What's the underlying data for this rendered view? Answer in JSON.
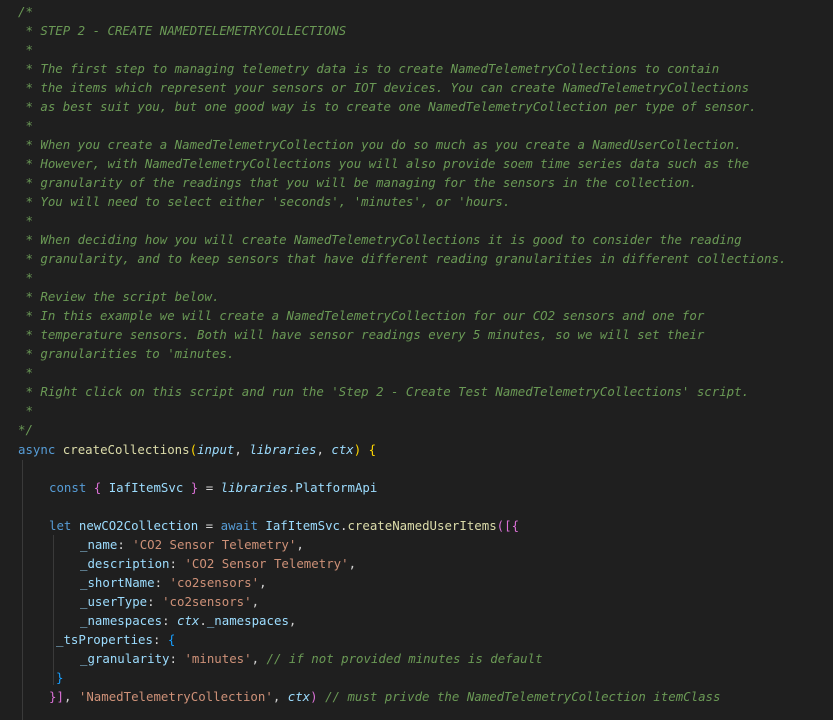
{
  "editor": {
    "comment": {
      "lines": [
        "/*",
        " * STEP 2 - CREATE NAMEDTELEMETRYCOLLECTIONS",
        " *",
        " * The first step to managing telemetry data is to create NamedTelemetryCollections to contain",
        " * the items which represent your sensors or IOT devices. You can create NamedTelemetryCollections",
        " * as best suit you, but one good way is to create one NamedTelemetryCollection per type of sensor.",
        " *",
        " * When you create a NamedTelemetryCollection you do so much as you create a NamedUserCollection.",
        " * However, with NamedTelemetryCollections you will also provide soem time series data such as the",
        " * granularity of the readings that you will be managing for the sensors in the collection.",
        " * You will need to select either 'seconds', 'minutes', or 'hours.",
        " *",
        " * When deciding how you will create NamedTelemetryCollections it is good to consider the reading",
        " * granularity, and to keep sensors that have different reading granularities in different collections.",
        " *",
        " * Review the script below.",
        " * In this example we will create a NamedTelemetryCollection for our CO2 sensors and one for",
        " * temperature sensors. Both will have sensor readings every 5 minutes, so we will set their",
        " * granularities to 'minutes.",
        " *",
        " * Right click on this script and run the 'Step 2 - Create Test NamedTelemetryCollections' script.",
        " *",
        "*/"
      ]
    },
    "code": {
      "async_kw": "async",
      "fn_name": "createCollections",
      "open_paren": "(",
      "p_input": "input",
      "p_libraries": "libraries",
      "p_ctx": "ctx",
      "comma_sep": ", ",
      "close_paren_brace": ") {",
      "const_kw": "const",
      "destructure_open": "{",
      "iaf_svc": "IafItemSvc",
      "destructure_close": "}",
      "equals": " = ",
      "libraries_ref": "libraries",
      "dot": ".",
      "platform_api": "PlatformApi",
      "let_kw": "let",
      "new_var": "newCO2Collection",
      "await_kw": "await",
      "method": "createNamedUserItems",
      "open_call": "([{",
      "k_name": "_name",
      "v_name": "'CO2 Sensor Telemetry'",
      "k_description": "_description",
      "v_description": "'CO2 Sensor Telemetry'",
      "k_shortName": "_shortName",
      "v_shortName": "'co2sensors'",
      "k_userType": "_userType",
      "v_userType": "'co2sensors'",
      "k_namespaces": "_namespaces",
      "v_namespaces_obj": "ctx",
      "v_namespaces_prop": "_namespaces",
      "k_tsProperties": "_tsProperties",
      "k_granularity": "_granularity",
      "v_granularity": "'minutes'",
      "granularity_comment": "// if not provided minutes is default",
      "close_ts": "}",
      "close_obj": "}",
      "close_arr": "]",
      "item_class": "'NamedTelemetryCollection'",
      "ctx_arg": "ctx",
      "close_call": ")",
      "final_comment": "// must privde the NamedTelemetryCollection itemClass"
    }
  }
}
